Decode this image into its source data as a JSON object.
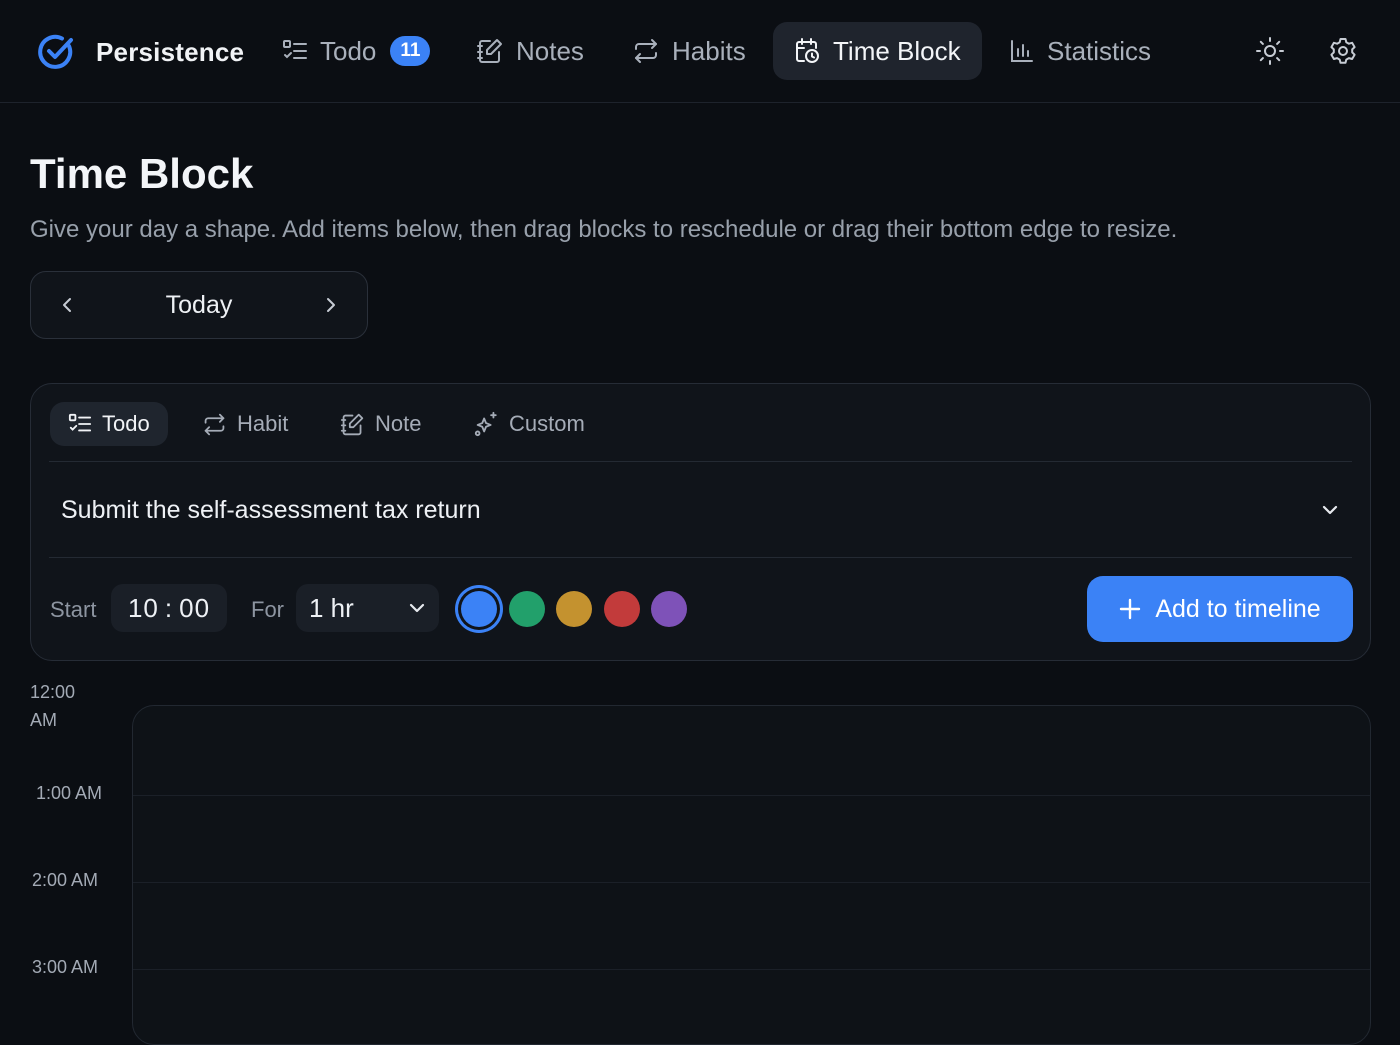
{
  "app": {
    "name": "Persistence",
    "accent": "#3b82f6"
  },
  "nav": {
    "items": [
      {
        "label": "Todo",
        "icon": "list-checks-icon",
        "badge": "11"
      },
      {
        "label": "Notes",
        "icon": "note-edit-icon"
      },
      {
        "label": "Habits",
        "icon": "repeat-icon"
      },
      {
        "label": "Time Block",
        "icon": "calendar-clock-icon",
        "active": true
      },
      {
        "label": "Statistics",
        "icon": "bar-chart-icon"
      }
    ],
    "actions": [
      {
        "icon": "sun-icon"
      },
      {
        "icon": "gear-icon"
      }
    ]
  },
  "page": {
    "title": "Time Block",
    "subtitle": "Give your day a shape. Add items below, then drag blocks to reschedule or drag their bottom edge to resize."
  },
  "date_nav": {
    "label": "Today"
  },
  "composer": {
    "tabs": [
      {
        "label": "Todo",
        "icon": "list-checks-icon",
        "active": true
      },
      {
        "label": "Habit",
        "icon": "repeat-icon"
      },
      {
        "label": "Note",
        "icon": "note-edit-icon"
      },
      {
        "label": "Custom",
        "icon": "sparkles-icon"
      }
    ],
    "selected_item": "Submit the self-assessment tax return",
    "start_label": "Start",
    "start_hour": "10",
    "start_minute": "00",
    "for_label": "For",
    "duration": "1 hr",
    "colors": [
      "#3b82f6",
      "#22a06b",
      "#c4922f",
      "#c23b3b",
      "#7e52b8"
    ],
    "selected_color": "#3b82f6",
    "add_label": "Add to timeline"
  },
  "timeline": {
    "hours": [
      "12:00 AM",
      "1:00 AM",
      "2:00 AM",
      "3:00 AM"
    ]
  }
}
